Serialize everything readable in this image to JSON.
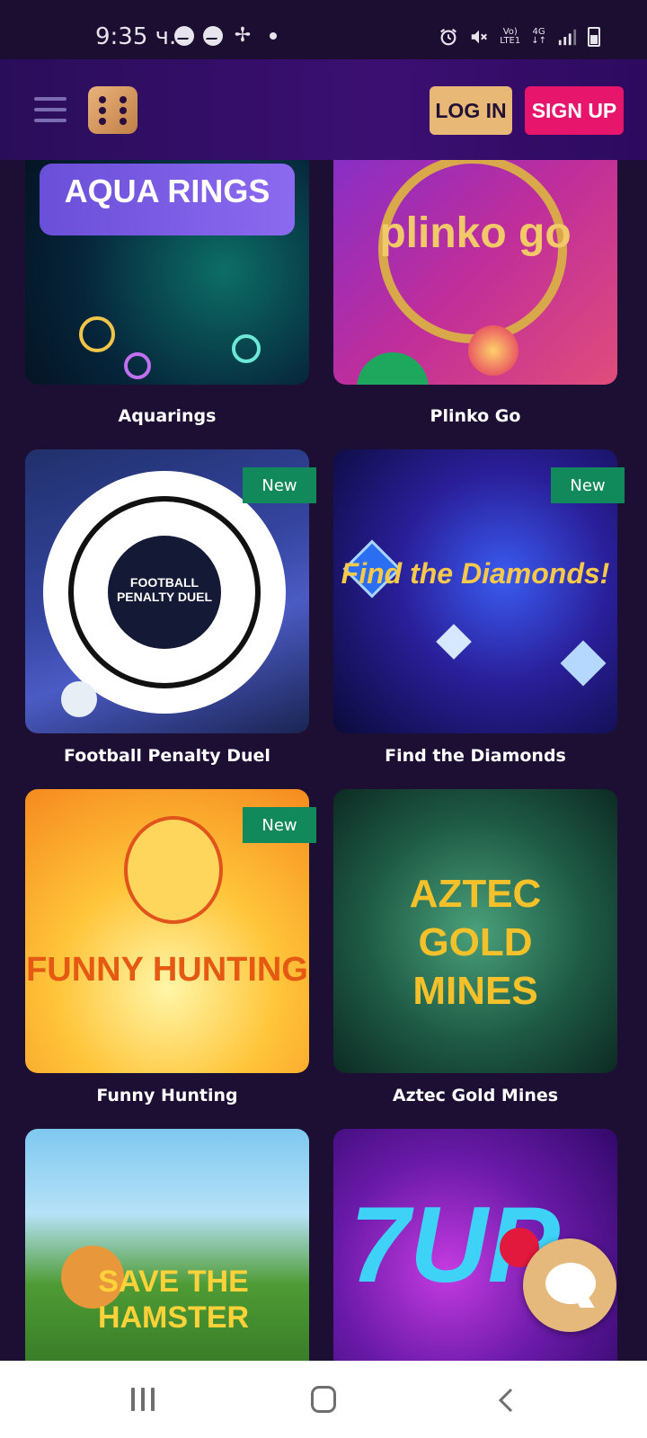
{
  "status_bar": {
    "time": "9:35 ч.",
    "network_top": "Vo)",
    "network_bottom": "LTE1",
    "network_type": "4G",
    "icons": [
      "messenger-icon",
      "messenger-icon",
      "fan-icon",
      "dot-icon",
      "alarm-icon",
      "mute-icon",
      "signal-icon",
      "battery-icon"
    ]
  },
  "header": {
    "login_label": "LOG IN",
    "signup_label": "SIGN UP",
    "colors": {
      "login": "#e8b877",
      "signup": "#e7156b",
      "header_bg": "#3b0f72"
    }
  },
  "games": [
    {
      "title": "Aquarings",
      "thumb_text": "AQUA RINGS",
      "new": false
    },
    {
      "title": "Plinko Go",
      "thumb_text": "plinko go",
      "new": false
    },
    {
      "title": "Football Penalty Duel",
      "thumb_text": "FOOTBALL PENALTY DUEL",
      "new": true,
      "badge": "New"
    },
    {
      "title": "Find the Diamonds",
      "thumb_text": "Find the Diamonds!",
      "new": true,
      "badge": "New"
    },
    {
      "title": "Funny Hunting",
      "thumb_text": "FUNNY HUNTING",
      "new": true,
      "badge": "New"
    },
    {
      "title": "Aztec Gold Mines",
      "thumb_text": "AZTEC GOLD MINES",
      "new": false
    },
    {
      "title": "",
      "thumb_text": "SAVE THE HAMSTER",
      "new": false
    },
    {
      "title": "",
      "thumb_text": "7UP",
      "new": false
    }
  ],
  "chat": {
    "icon": "chat-icon"
  },
  "nav_bar": {
    "icons": [
      "recent-apps-icon",
      "home-icon",
      "back-icon"
    ]
  }
}
